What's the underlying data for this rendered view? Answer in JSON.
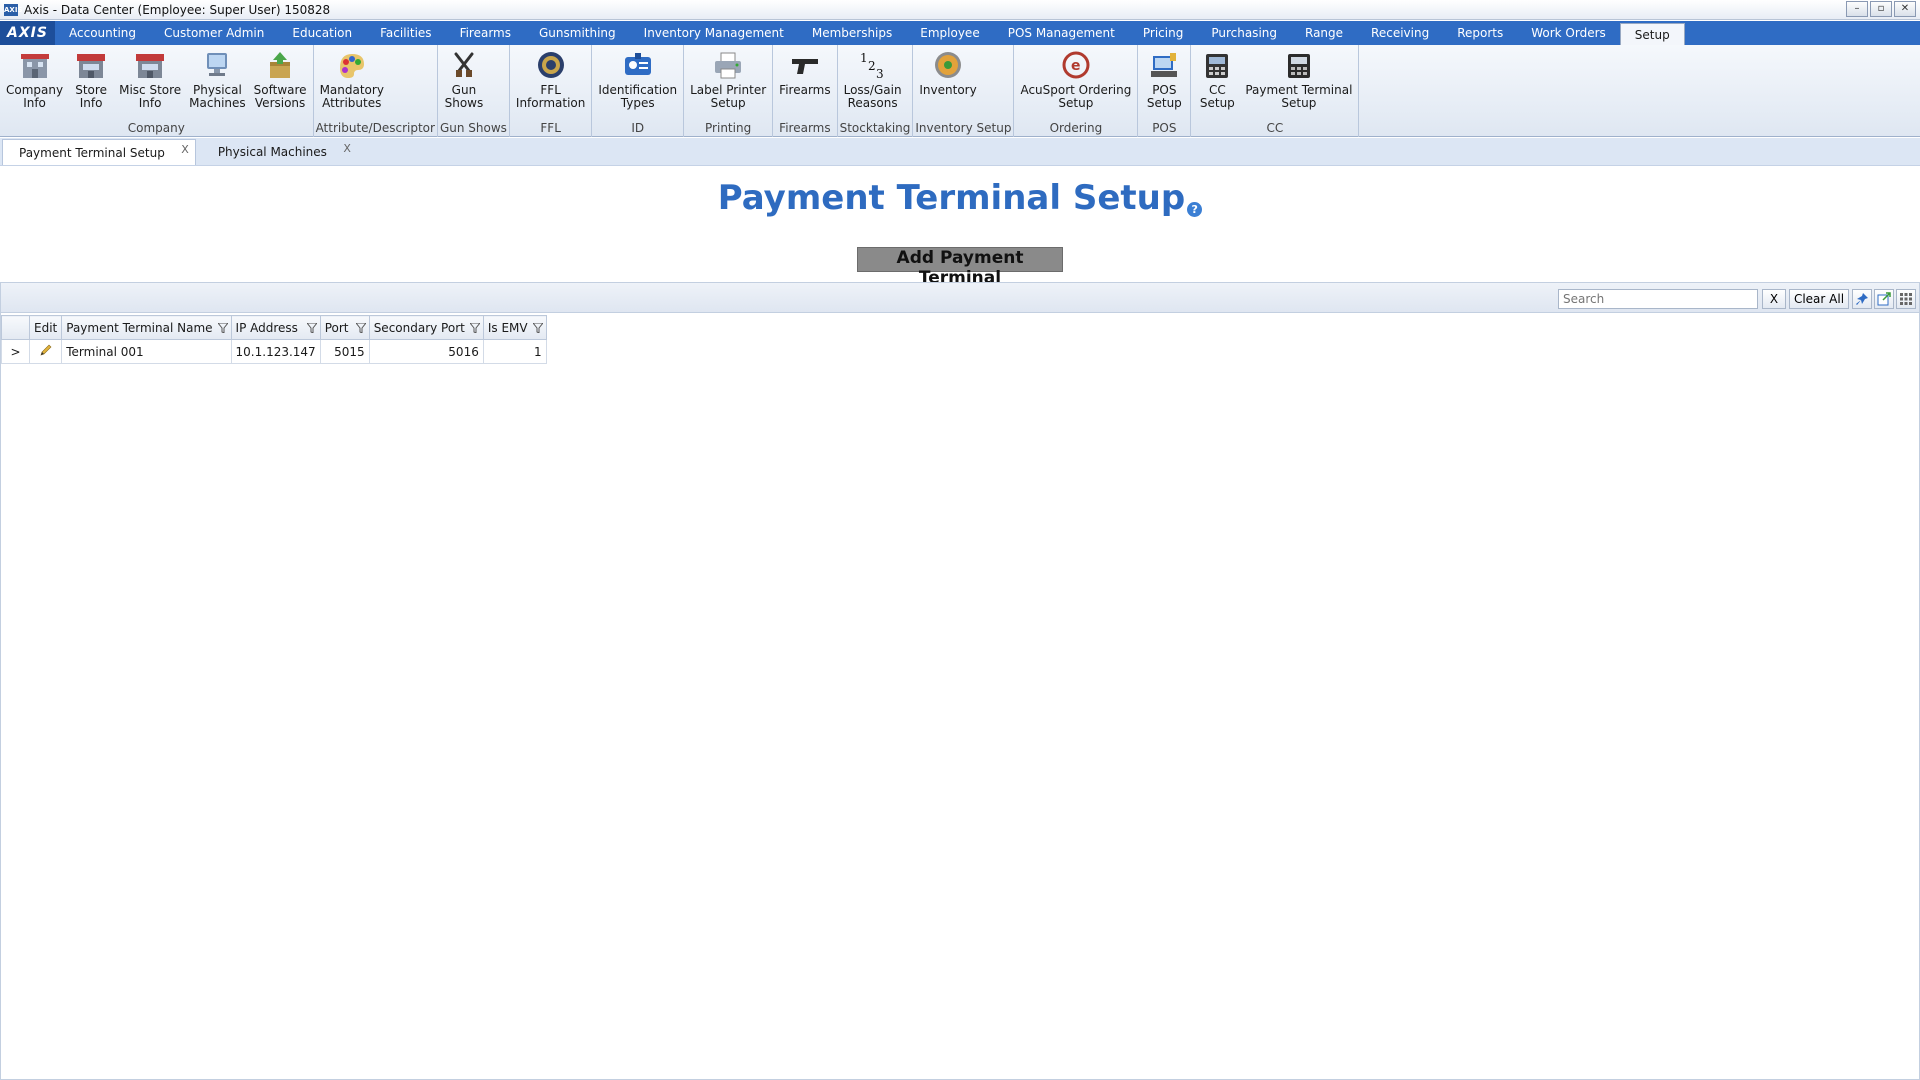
{
  "window": {
    "title": "Axis - Data Center  (Employee: Super User) 150828",
    "app_icon_text": "AXIS",
    "minimize": "–",
    "maximize": "▫",
    "close": "✕"
  },
  "menubar": {
    "logo": "AXIS",
    "items": [
      {
        "label": "Accounting"
      },
      {
        "label": "Customer Admin"
      },
      {
        "label": "Education"
      },
      {
        "label": "Facilities"
      },
      {
        "label": "Firearms"
      },
      {
        "label": "Gunsmithing"
      },
      {
        "label": "Inventory Management"
      },
      {
        "label": "Memberships"
      },
      {
        "label": "Employee"
      },
      {
        "label": "POS Management"
      },
      {
        "label": "Pricing"
      },
      {
        "label": "Purchasing"
      },
      {
        "label": "Range"
      },
      {
        "label": "Receiving"
      },
      {
        "label": "Reports"
      },
      {
        "label": "Work Orders"
      },
      {
        "label": "Setup"
      }
    ],
    "active": "Setup"
  },
  "ribbon": {
    "groups": [
      {
        "label": "Company",
        "buttons": [
          {
            "label": "Company\nInfo",
            "icon": "building-icon"
          },
          {
            "label": "Store\nInfo",
            "icon": "store-icon"
          },
          {
            "label": "Misc Store\nInfo",
            "icon": "store-icon"
          },
          {
            "label": "Physical\nMachines",
            "icon": "computer-icon"
          },
          {
            "label": "Software\nVersions",
            "icon": "software-box-icon"
          }
        ]
      },
      {
        "label": "Attribute/Descriptor",
        "buttons": [
          {
            "label": "Mandatory\nAttributes",
            "icon": "paint-palette-icon"
          }
        ]
      },
      {
        "label": "Gun Shows",
        "buttons": [
          {
            "label": "Gun\nShows",
            "icon": "crossed-pistols-icon"
          }
        ]
      },
      {
        "label": "FFL",
        "buttons": [
          {
            "label": "FFL\nInformation",
            "icon": "seal-icon"
          }
        ]
      },
      {
        "label": "ID",
        "buttons": [
          {
            "label": "Identification\nTypes",
            "icon": "id-card-icon"
          }
        ]
      },
      {
        "label": "Printing",
        "buttons": [
          {
            "label": "Label Printer\nSetup",
            "icon": "printer-icon"
          }
        ]
      },
      {
        "label": "Firearms",
        "buttons": [
          {
            "label": "Firearms",
            "icon": "pistol-icon"
          }
        ]
      },
      {
        "label": "Stocktaking",
        "buttons": [
          {
            "label": "Loss/Gain\nReasons",
            "icon": "numbers-icon"
          }
        ]
      },
      {
        "label": "Inventory Setup",
        "buttons": [
          {
            "label": "Inventory",
            "icon": "inventory-gauge-icon"
          }
        ]
      },
      {
        "label": "Ordering",
        "buttons": [
          {
            "label": "AcuSport Ordering\nSetup",
            "icon": "acusport-logo-icon"
          }
        ]
      },
      {
        "label": "POS",
        "buttons": [
          {
            "label": "POS\nSetup",
            "icon": "pos-terminal-icon"
          }
        ]
      },
      {
        "label": "CC",
        "buttons": [
          {
            "label": "CC\nSetup",
            "icon": "card-reader-icon"
          },
          {
            "label": "Payment Terminal\nSetup",
            "icon": "payment-terminal-icon"
          }
        ]
      }
    ]
  },
  "doc_tabs": [
    {
      "label": "Payment Terminal Setup",
      "close": "X",
      "active": true
    },
    {
      "label": "Physical Machines",
      "close": "X",
      "active": false
    }
  ],
  "page": {
    "title": "Payment Terminal Setup",
    "help": "?",
    "add_button": "Add Payment Terminal"
  },
  "grid": {
    "search_placeholder": "Search",
    "clear_x": "X",
    "clear_all": "Clear All",
    "columns": [
      "Edit",
      "Payment Terminal Name",
      "IP Address",
      "Port",
      "Secondary Port",
      "Is EMV"
    ],
    "rows": [
      {
        "expander": ">",
        "name": "Terminal 001",
        "ip": "10.1.123.147",
        "port": "5015",
        "secondary_port": "5016",
        "is_emv": "1"
      }
    ]
  },
  "colors": {
    "menubar": "#2f6cc4",
    "title_blue": "#2e6bc0",
    "ribbon_bg": "#dfe7f2"
  }
}
